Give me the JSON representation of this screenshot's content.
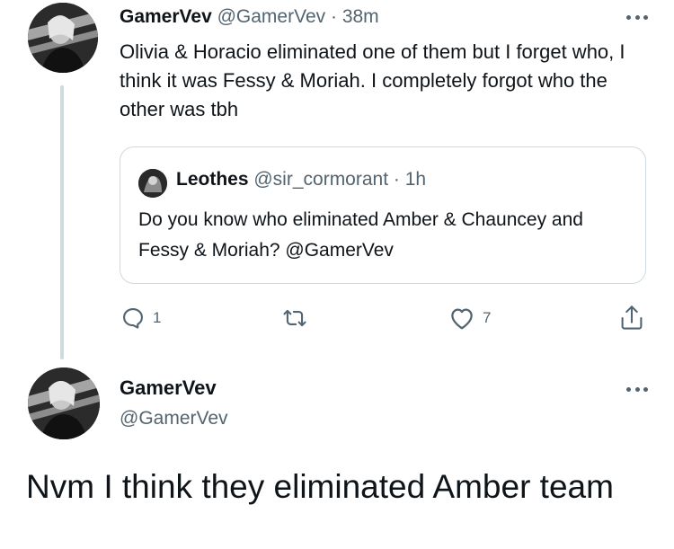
{
  "tweet1": {
    "display_name": "GamerVev",
    "handle": "@GamerVev",
    "separator": "·",
    "time": "38m",
    "text": "Olivia & Horacio eliminated one of them but I forget who, I think it was Fessy & Moriah. I completely forgot who the other was tbh",
    "avatar_icon": "profile-photo-icon",
    "more_icon": "more-dots-icon",
    "quote": {
      "display_name": "Leothes",
      "handle": "@sir_cormorant",
      "separator": "·",
      "time": "1h",
      "text": "Do you know who eliminated Amber & Chauncey and Fessy & Moriah? @GamerVev",
      "avatar_icon": "profile-photo-icon"
    },
    "actions": {
      "reply_count": "1",
      "retweet_count": "",
      "like_count": "7",
      "reply_icon": "reply-icon",
      "retweet_icon": "retweet-icon",
      "like_icon": "heart-icon",
      "share_icon": "share-icon"
    }
  },
  "tweet2": {
    "display_name": "GamerVev",
    "handle": "@GamerVev",
    "text": "Nvm I think they eliminated Amber team",
    "avatar_icon": "profile-photo-icon",
    "more_icon": "more-dots-icon"
  },
  "colors": {
    "text": "#0f1419",
    "muted": "#536471",
    "border": "#cfd9de",
    "background": "#ffffff"
  }
}
